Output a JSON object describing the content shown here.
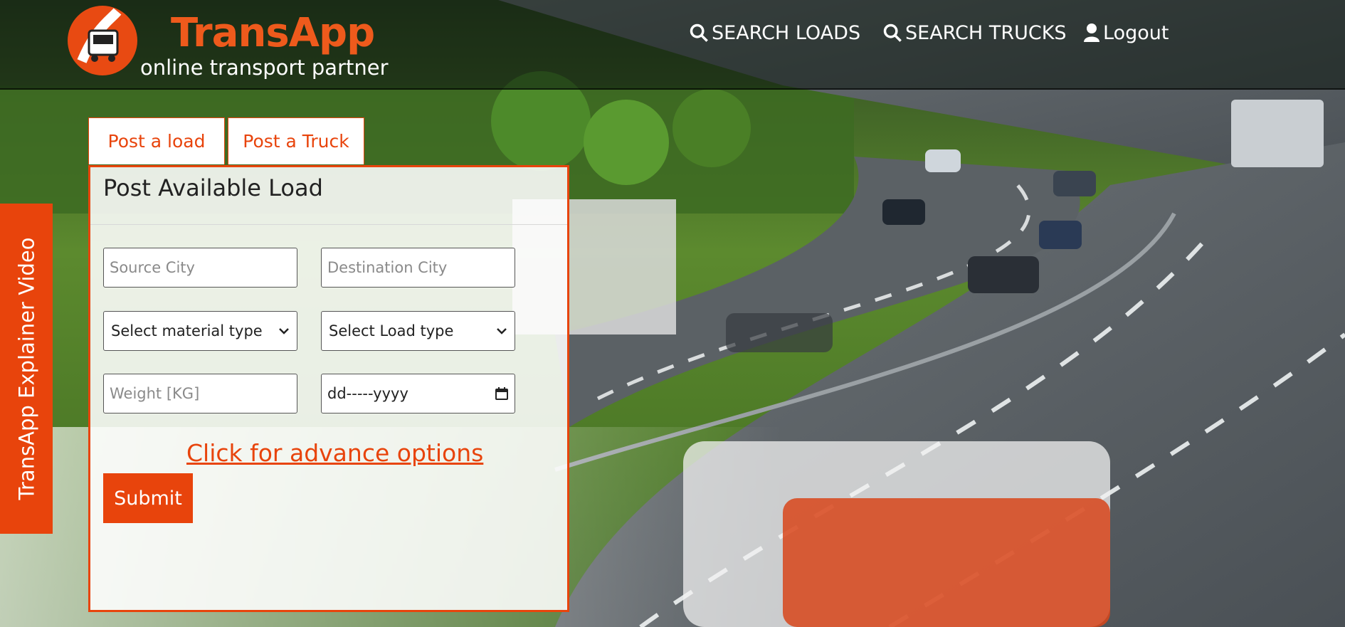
{
  "brand": {
    "name": "TransApp",
    "tagline": "online transport partner",
    "accent": "#e8440c"
  },
  "nav": {
    "search_loads": "SEARCH LOADS",
    "search_trucks": "SEARCH TRUCKS",
    "logout": "Logout"
  },
  "side_tab": {
    "label": "TransApp Explainer Video"
  },
  "tabs": [
    {
      "label": "Post a load"
    },
    {
      "label": "Post a Truck"
    }
  ],
  "form": {
    "title": "Post Available Load",
    "source_city": {
      "placeholder": "Source City",
      "value": ""
    },
    "destination_city": {
      "placeholder": "Destination City",
      "value": ""
    },
    "material_type": {
      "selected": "Select material type"
    },
    "load_type": {
      "selected": "Select Load type"
    },
    "weight": {
      "placeholder": "Weight [KG]",
      "value": ""
    },
    "date": {
      "placeholder": "dd-----yyyy"
    },
    "advance_link": "Click for advance options",
    "submit_label": "Submit"
  }
}
